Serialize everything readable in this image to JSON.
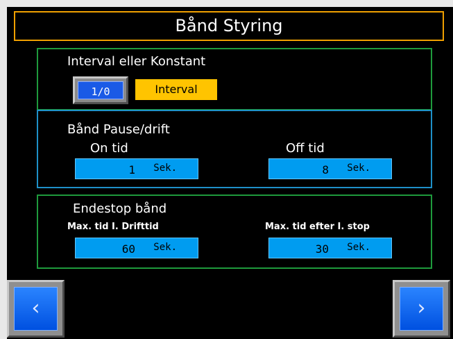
{
  "title": "Bånd Styring",
  "interval_section": {
    "heading": "Interval eller Konstant",
    "toggle_label": "1/0",
    "mode_value": "Interval"
  },
  "pause_section": {
    "heading": "Bånd Pause/drift",
    "on_label": "On tid",
    "off_label": "Off tid",
    "on_value": "1",
    "off_value": "8",
    "unit": "Sek."
  },
  "endstop_section": {
    "heading": "Endestop bånd",
    "max_drift_label": "Max. tid I. Drifttid",
    "max_stop_label": "Max. tid efter I. stop",
    "max_drift_value": "60",
    "max_stop_value": "30",
    "unit": "Sek."
  },
  "nav": {
    "prev_glyph": "‹",
    "next_glyph": "›"
  },
  "colors": {
    "title_border": "#f0a000",
    "panel_green": "#1e9a3c",
    "panel_blue": "#1e90c8",
    "field_fill": "#009cf0",
    "badge_fill": "#ffc400",
    "button_blue": "#1a5ae6"
  }
}
